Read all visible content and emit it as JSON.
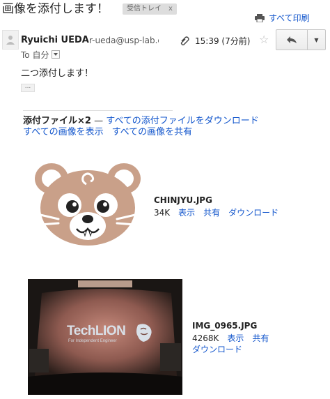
{
  "subject": "画像を添付します！",
  "label": {
    "name": "受信トレイ",
    "remove": "x"
  },
  "print_all": "すべて印刷",
  "message": {
    "sender_name": "Ryuichi UEDA",
    "sender_email": "r-ueda@usp-lab.com",
    "time": "15:39 (7分前)",
    "to": "To 自分",
    "body": "二つ添付します！",
    "ellipsis": "..."
  },
  "attachments_header": {
    "count_label": "添付ファイル×2",
    "dash": "—",
    "download_all": "すべての添付ファイルをダウンロード",
    "view_all_images": "すべての画像を表示",
    "share_all_images": "すべての画像を共有"
  },
  "attachments": [
    {
      "name": "CHINJYU.JPG",
      "size": "34K",
      "view": "表示",
      "share": "共有",
      "download": "ダウンロード"
    },
    {
      "name": "IMG_0965.JPG",
      "size": "4268K",
      "view": "表示",
      "share": "共有",
      "download": "ダウンロード",
      "image_text": {
        "brand": "TechLION",
        "tagline": "For Independent Engineer"
      }
    }
  ],
  "colors": {
    "link": "#1155cc",
    "mascot": "#c9a089",
    "mascot_dark": "#b48a74"
  },
  "icons": [
    "printer-icon",
    "avatar-icon",
    "paperclip-icon",
    "star-icon",
    "reply-icon",
    "chevron-down-icon",
    "lion-logo-icon"
  ]
}
